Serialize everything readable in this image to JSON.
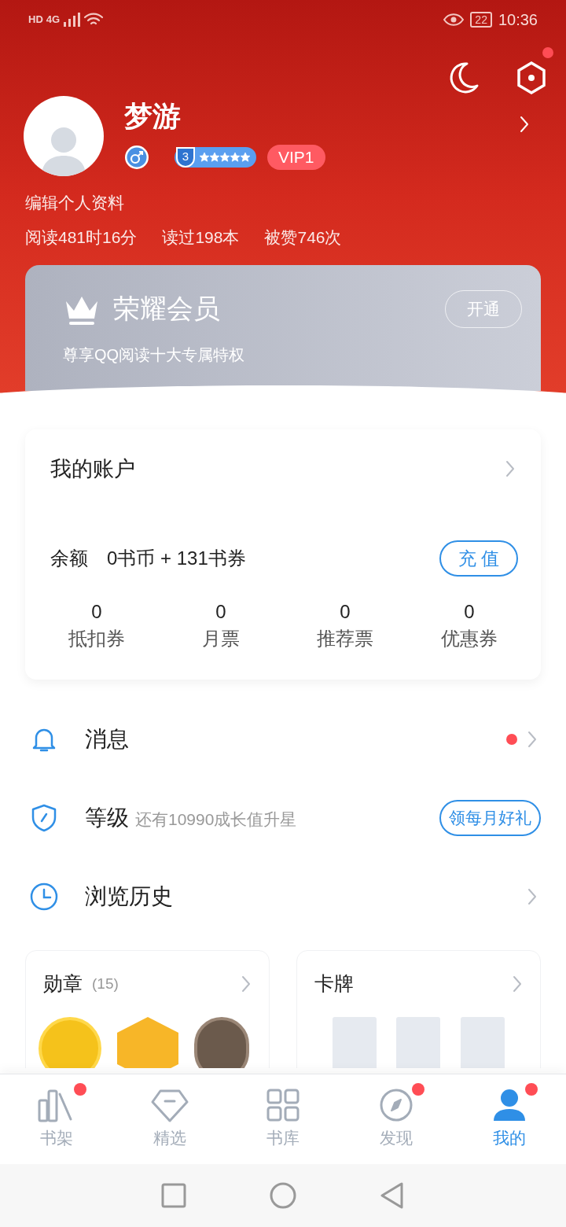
{
  "status_bar": {
    "network": [
      "HD",
      "4G"
    ],
    "battery": "22",
    "time": "10:36"
  },
  "header": {
    "settings_dot": true
  },
  "profile": {
    "name": "梦游",
    "level": "3",
    "stars": 5,
    "vip": "VIP1",
    "edit_link": "编辑个人资料",
    "stats": [
      "阅读481时16分",
      "读过198本",
      "被赞746次"
    ]
  },
  "membership": {
    "title": "荣耀会员",
    "subtitle": "尊享QQ阅读十大专属特权",
    "button": "开通"
  },
  "account": {
    "title": "我的账户",
    "balance_label": "余额",
    "balance": "0书币 + 131书券",
    "recharge": "充 值",
    "items": [
      {
        "value": "0",
        "label": "抵扣券"
      },
      {
        "value": "0",
        "label": "月票"
      },
      {
        "value": "0",
        "label": "推荐票"
      },
      {
        "value": "0",
        "label": "优惠券"
      }
    ]
  },
  "menu": [
    {
      "kind": "message",
      "label": "消息",
      "unread": true
    },
    {
      "kind": "level",
      "label": "等级",
      "hint": "还有10990成长值升星",
      "button": "领每月好礼"
    },
    {
      "kind": "history",
      "label": "浏览历史"
    }
  ],
  "cards": [
    {
      "kind": "medals",
      "title": "勋章",
      "count": "(15)"
    },
    {
      "kind": "cards",
      "title": "卡牌"
    }
  ],
  "tabs": [
    {
      "kind": "shelf",
      "label": "书架",
      "selected": false,
      "dot": true
    },
    {
      "kind": "featured",
      "label": "精选",
      "selected": false,
      "dot": false
    },
    {
      "kind": "library",
      "label": "书库",
      "selected": false,
      "dot": false
    },
    {
      "kind": "discover",
      "label": "发现",
      "selected": false,
      "dot": true
    },
    {
      "kind": "me",
      "label": "我的",
      "selected": true,
      "dot": true
    }
  ]
}
